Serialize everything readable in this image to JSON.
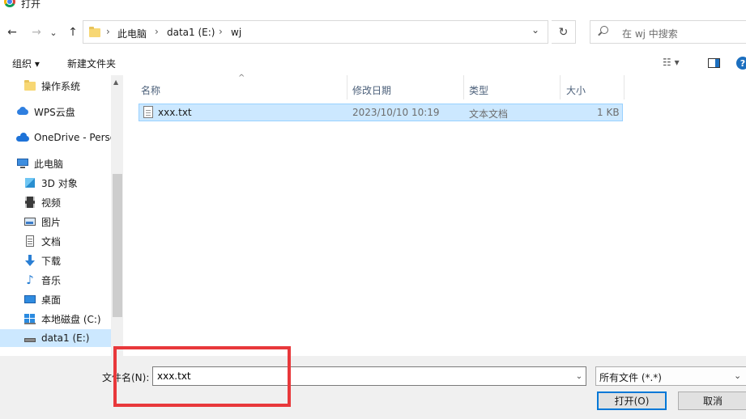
{
  "window": {
    "title": "打开"
  },
  "nav": {
    "back_glyph": "←",
    "forward_glyph": "→",
    "recent_glyph": "⌄",
    "up_glyph": "↑",
    "breadcrumb": [
      "此电脑",
      "data1 (E:)",
      "wj"
    ],
    "crumb_sep": "›",
    "address_dropdown_glyph": "⌄",
    "refresh_glyph": "↻",
    "search_placeholder": "在 wj 中搜索"
  },
  "toolbar": {
    "organize_label": "组织 ▾",
    "new_folder_label": "新建文件夹",
    "view_glyph": "☷ ▾",
    "help_glyph": "?"
  },
  "sidebar": {
    "items": [
      {
        "label": "操作系统",
        "icon": "folder-icon"
      },
      {
        "label": "WPS云盘",
        "icon": "cloud-icon"
      },
      {
        "label": "OneDrive - Perso",
        "icon": "onedrive-icon"
      },
      {
        "label": "此电脑",
        "icon": "computer-icon"
      },
      {
        "label": "3D 对象",
        "icon": "cube-icon"
      },
      {
        "label": "视频",
        "icon": "video-icon"
      },
      {
        "label": "图片",
        "icon": "picture-icon"
      },
      {
        "label": "文档",
        "icon": "document-icon"
      },
      {
        "label": "下载",
        "icon": "download-icon"
      },
      {
        "label": "音乐",
        "icon": "music-icon"
      },
      {
        "label": "桌面",
        "icon": "desktop-icon"
      },
      {
        "label": "本地磁盘 (C:)",
        "icon": "drive-icon"
      },
      {
        "label": "data1 (E:)",
        "icon": "drive-icon"
      }
    ],
    "scroll_up_glyph": "▲"
  },
  "list": {
    "sort_glyph": "^",
    "columns": [
      "名称",
      "修改日期",
      "类型",
      "大小"
    ],
    "rows": [
      {
        "name": "xxx.txt",
        "modified": "2023/10/10 10:19",
        "type": "文本文档",
        "size": "1 KB"
      }
    ]
  },
  "bottom": {
    "filename_label": "文件名(N):",
    "filename_value": "xxx.txt",
    "filename_dropdown_glyph": "⌄",
    "filter_value": "所有文件 (*.*)",
    "filter_dropdown_glyph": "⌄",
    "open_label": "打开(O)",
    "cancel_label": "取消"
  },
  "colors": {
    "selection": "#cce8ff",
    "annotation": "#e8383b",
    "accent": "#0078d7"
  }
}
